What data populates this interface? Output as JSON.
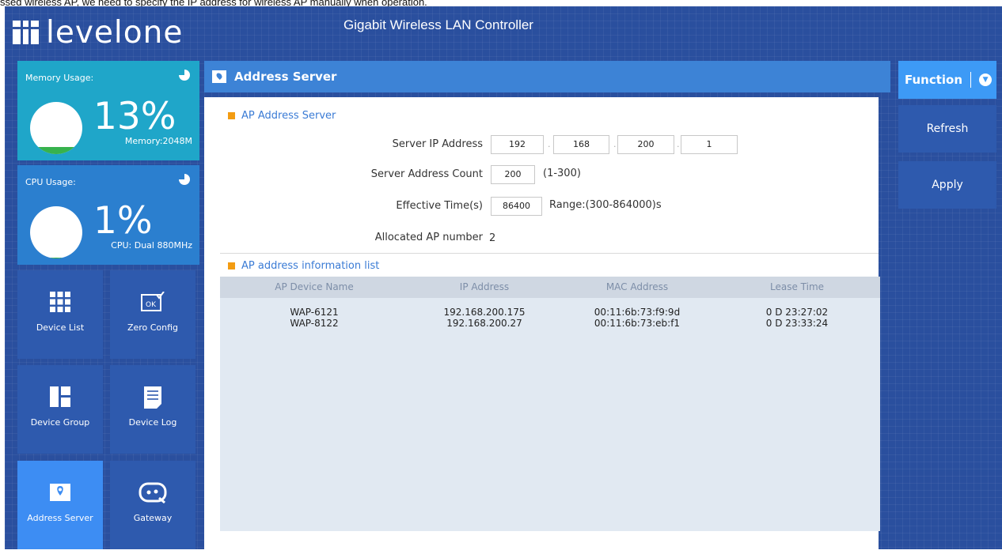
{
  "header": {
    "cut_text": "ssed wireless AP, we need to specify the IP address for wireless AP manually when operation.",
    "logo_text": "levelone",
    "app_title": "Gigabit Wireless LAN Controller"
  },
  "stats": {
    "memory": {
      "label": "Memory Usage:",
      "percent_text": "13%",
      "detail": "Memory:2048M",
      "usage_fraction": 0.13,
      "color": "#1fa6c9"
    },
    "cpu": {
      "label": "CPU Usage:",
      "percent_text": "1%",
      "detail": "CPU: Dual 880MHz",
      "usage_fraction": 0.01,
      "color": "#2b7fcf"
    }
  },
  "nav": {
    "items": [
      {
        "label": "Device List",
        "icon": "grid-icon"
      },
      {
        "label": "Zero Config",
        "icon": "ok-icon"
      },
      {
        "label": "Device Group",
        "icon": "group-icon"
      },
      {
        "label": "Device Log",
        "icon": "document-icon"
      },
      {
        "label": "Address Server",
        "icon": "location-icon",
        "active": true
      },
      {
        "label": "Gateway",
        "icon": "gateway-icon"
      }
    ]
  },
  "main": {
    "title": "Address Server",
    "section1": "AP Address Server",
    "server_ip": {
      "label": "Server IP Address",
      "octets": [
        "192",
        "168",
        "200",
        "1"
      ]
    },
    "address_count": {
      "label": "Server Address Count",
      "value": "200",
      "hint": "(1-300)"
    },
    "effective_time": {
      "label": "Effective Time(s)",
      "value": "86400",
      "hint": "Range:(300-864000)s"
    },
    "allocated": {
      "label": "Allocated AP number",
      "value": "2"
    },
    "section2": "AP address information list",
    "table": {
      "headers": [
        "AP Device Name",
        "IP Address",
        "MAC Address",
        "Lease Time"
      ],
      "rows": [
        [
          "WAP-6121",
          "192.168.200.175",
          "00:11:6b:73:f9:9d",
          "0 D 23:27:02"
        ],
        [
          "WAP-8122",
          "192.168.200.27",
          "00:11:6b:73:eb:f1",
          "0 D 23:33:24"
        ]
      ]
    }
  },
  "actions": {
    "function_label": "Function",
    "refresh_label": "Refresh",
    "apply_label": "Apply"
  },
  "colors": {
    "background": "#2a4f9e",
    "accent": "#3d83d6",
    "active_nav": "#3d8df3",
    "section_marker": "#f39c12"
  }
}
